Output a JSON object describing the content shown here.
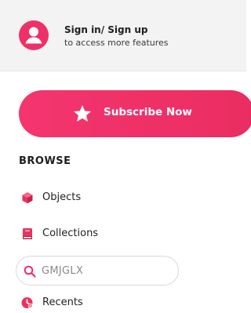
{
  "header": {
    "title": "Sign in/ Sign up",
    "subtitle": "to access more features"
  },
  "subscribe": {
    "label": "Subscribe Now"
  },
  "browse": {
    "heading": "BROWSE",
    "items": [
      {
        "label": "Objects",
        "icon": "cube-icon"
      },
      {
        "label": "Collections",
        "icon": "book-icon"
      },
      {
        "label": "Recents",
        "icon": "recents-icon"
      }
    ]
  },
  "search": {
    "value": "GMJGLX",
    "icon": "search-icon"
  },
  "colors": {
    "accent": "#ef3068",
    "header_bg": "#f3f3f4"
  }
}
